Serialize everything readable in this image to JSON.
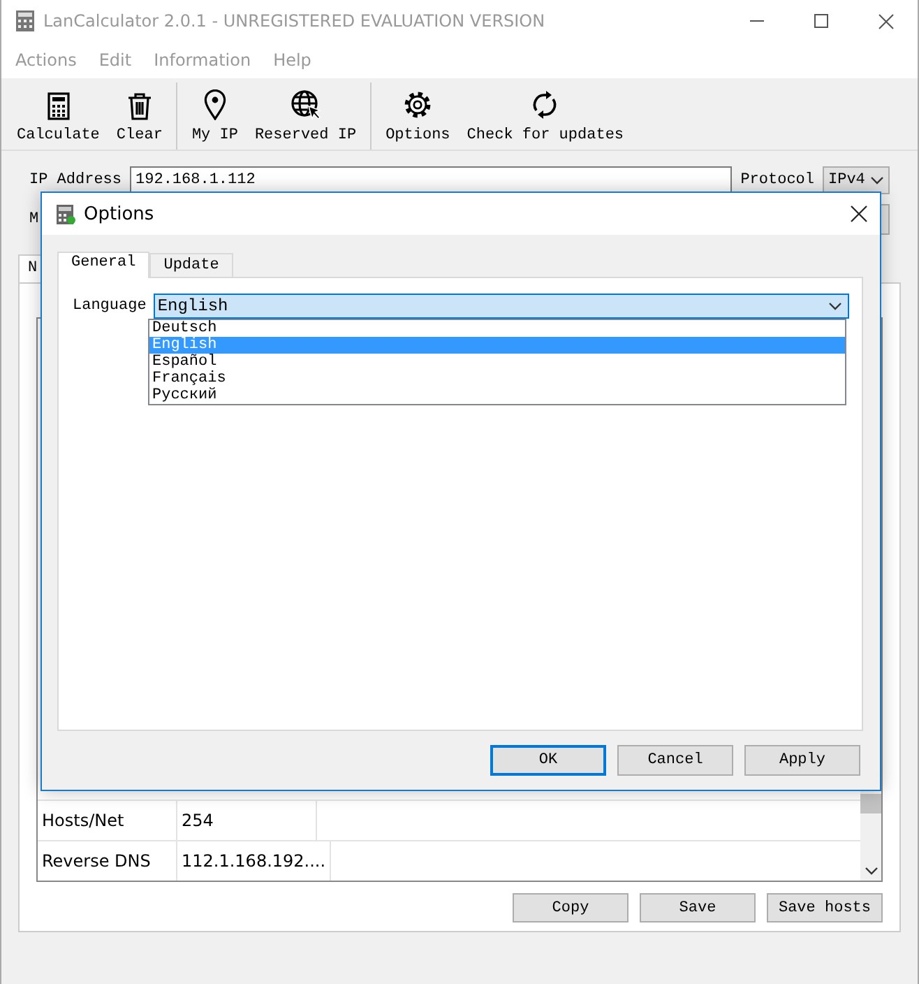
{
  "window": {
    "title": "LanCalculator 2.0.1 - UNREGISTERED EVALUATION VERSION"
  },
  "menu": [
    "Actions",
    "Edit",
    "Information",
    "Help"
  ],
  "toolbar": [
    {
      "label": "Calculate",
      "kind": "calculator",
      "separator_before": false
    },
    {
      "label": "Clear",
      "kind": "trash",
      "separator_before": false
    },
    {
      "label": "My IP",
      "kind": "pin",
      "separator_before": true
    },
    {
      "label": "Reserved IP",
      "kind": "globe",
      "separator_before": false
    },
    {
      "label": "Options",
      "kind": "gear",
      "separator_before": true
    },
    {
      "label": "Check for updates",
      "kind": "refresh",
      "separator_before": false
    }
  ],
  "form": {
    "ip_label": "IP Address",
    "ip_value": "192.168.1.112",
    "protocol_label": "Protocol",
    "protocol_value": "IPv4",
    "row2_label": "M"
  },
  "main_tab": {
    "label": "N"
  },
  "table": {
    "rows": [
      [
        "Hosts/Net",
        "254"
      ],
      [
        "Reverse DNS",
        "112.1.168.192...."
      ]
    ]
  },
  "buttons": [
    "Copy",
    "Save",
    "Save hosts"
  ],
  "dialog": {
    "title": "Options",
    "tabs": [
      {
        "label": "General",
        "selected": true
      },
      {
        "label": "Update",
        "selected": false
      }
    ],
    "language": {
      "label": "Language",
      "value": "English",
      "expanded": true,
      "options": [
        {
          "label": "Deutsch",
          "selected": false
        },
        {
          "label": "English",
          "selected": true
        },
        {
          "label": "Español",
          "selected": false
        },
        {
          "label": "Français",
          "selected": false
        },
        {
          "label": "Русский",
          "selected": false
        }
      ]
    },
    "buttons": [
      {
        "label": "OK",
        "default": true
      },
      {
        "label": "Cancel",
        "default": false
      },
      {
        "label": "Apply",
        "default": false
      }
    ]
  }
}
